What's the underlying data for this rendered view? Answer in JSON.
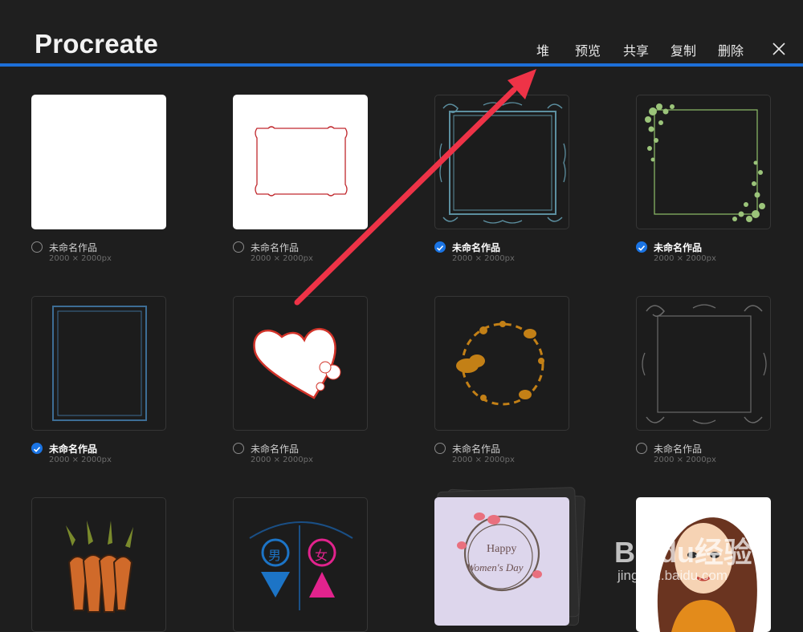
{
  "app": {
    "title": "Procreate"
  },
  "toolbar": {
    "stack": "堆",
    "preview": "预览",
    "share": "共享",
    "duplicate": "复制",
    "delete": "删除"
  },
  "gallery": {
    "items": [
      {
        "name": "未命名作品",
        "size": "2000 × 2000px",
        "selected": false
      },
      {
        "name": "未命名作品",
        "size": "2000 × 2000px",
        "selected": false
      },
      {
        "name": "未命名作品",
        "size": "2000 × 2000px",
        "selected": true
      },
      {
        "name": "未命名作品",
        "size": "2000 × 2000px",
        "selected": true
      },
      {
        "name": "未命名作品",
        "size": "2000 × 2000px",
        "selected": true
      },
      {
        "name": "未命名作品",
        "size": "2000 × 2000px",
        "selected": false
      },
      {
        "name": "未命名作品",
        "size": "2000 × 2000px",
        "selected": false
      },
      {
        "name": "未命名作品",
        "size": "2000 × 2000px",
        "selected": false
      }
    ],
    "partial_row": [
      {
        "label_male": "男",
        "label_female": "女"
      },
      {
        "text_line1": "Happy",
        "text_line2": "Women's Day"
      }
    ]
  },
  "watermark": {
    "brand": "Baidu经验",
    "url": "jingyan.baidu.com"
  },
  "colors": {
    "accent": "#1d6fd8",
    "arrow": "#ee3347",
    "check": "#1a74e4"
  }
}
